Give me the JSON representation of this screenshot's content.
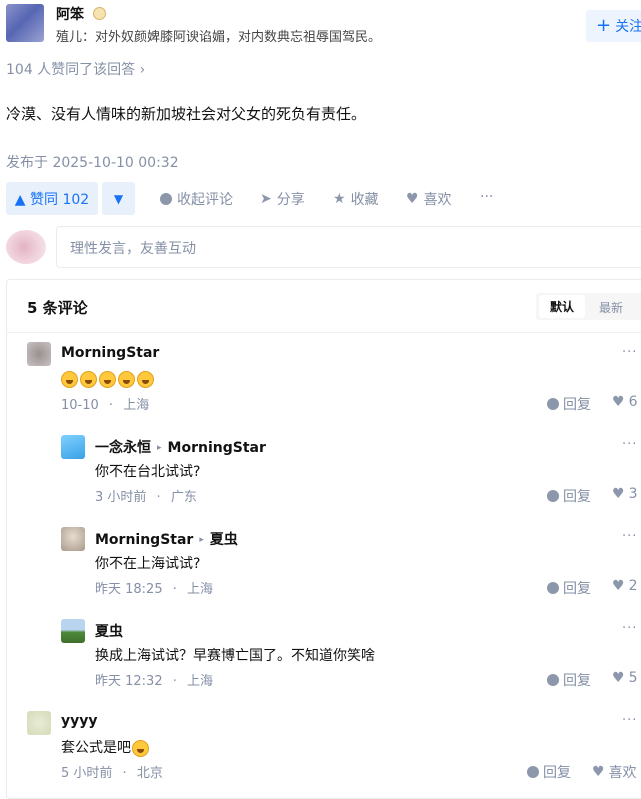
{
  "author": {
    "name": "阿笨",
    "bio": "殖儿：对外奴颜婢膝阿谀谄媚，对内数典忘祖辱国驾民。",
    "follow_label": "关注",
    "follow_icon": "plus-icon"
  },
  "answer": {
    "upvote_summary": "104 人赞同了该回答 ›",
    "text": "冷漠、没有人情味的新加坡社会对父女的死负有责任。",
    "published": "发布于 2025-10-10 00:32"
  },
  "actions": {
    "vote_label": "▲ 赞同 102",
    "down_label": "▼",
    "comment_label": "收起评论",
    "share_label": "分享",
    "favorite_label": "收藏",
    "like_label": "喜欢",
    "more_label": "···"
  },
  "comment_box": {
    "placeholder": "理性发言，友善互动"
  },
  "comments_panel": {
    "title": "5 条评论",
    "sort_default": "默认",
    "sort_latest": "最新"
  },
  "comments": [
    {
      "author": "MorningStar",
      "reply_to": "",
      "text": "",
      "emoji_count": 5,
      "time": "10-10",
      "location": "上海",
      "reply_label": "回复",
      "likes": "6",
      "more": "···"
    },
    {
      "author": "一念永恒",
      "reply_to": "MorningStar",
      "text": "你不在台北试试?",
      "time": "3 小时前",
      "location": "广东",
      "reply_label": "回复",
      "likes": "3",
      "more": "···"
    },
    {
      "author": "MorningStar",
      "reply_to": "夏虫",
      "text": "你不在上海试试?",
      "time": "昨天 18:25",
      "location": "上海",
      "reply_label": "回复",
      "likes": "2",
      "more": "···"
    },
    {
      "author": "夏虫",
      "reply_to": "",
      "text": "换成上海试试？早赛博亡国了。不知道你笑啥",
      "time": "昨天 12:32",
      "location": "上海",
      "reply_label": "回复",
      "likes": "5",
      "more": "···"
    },
    {
      "author": "yyyy",
      "reply_to": "",
      "text": "套公式是吧",
      "time": "5 小时前",
      "location": "北京",
      "reply_label": "回复",
      "likes": "喜欢",
      "more": "···"
    }
  ],
  "meta_separator": "·",
  "colors": {
    "accent": "#1772f6",
    "muted": "#8590a6",
    "accent_bg": "#e8f0fc"
  }
}
